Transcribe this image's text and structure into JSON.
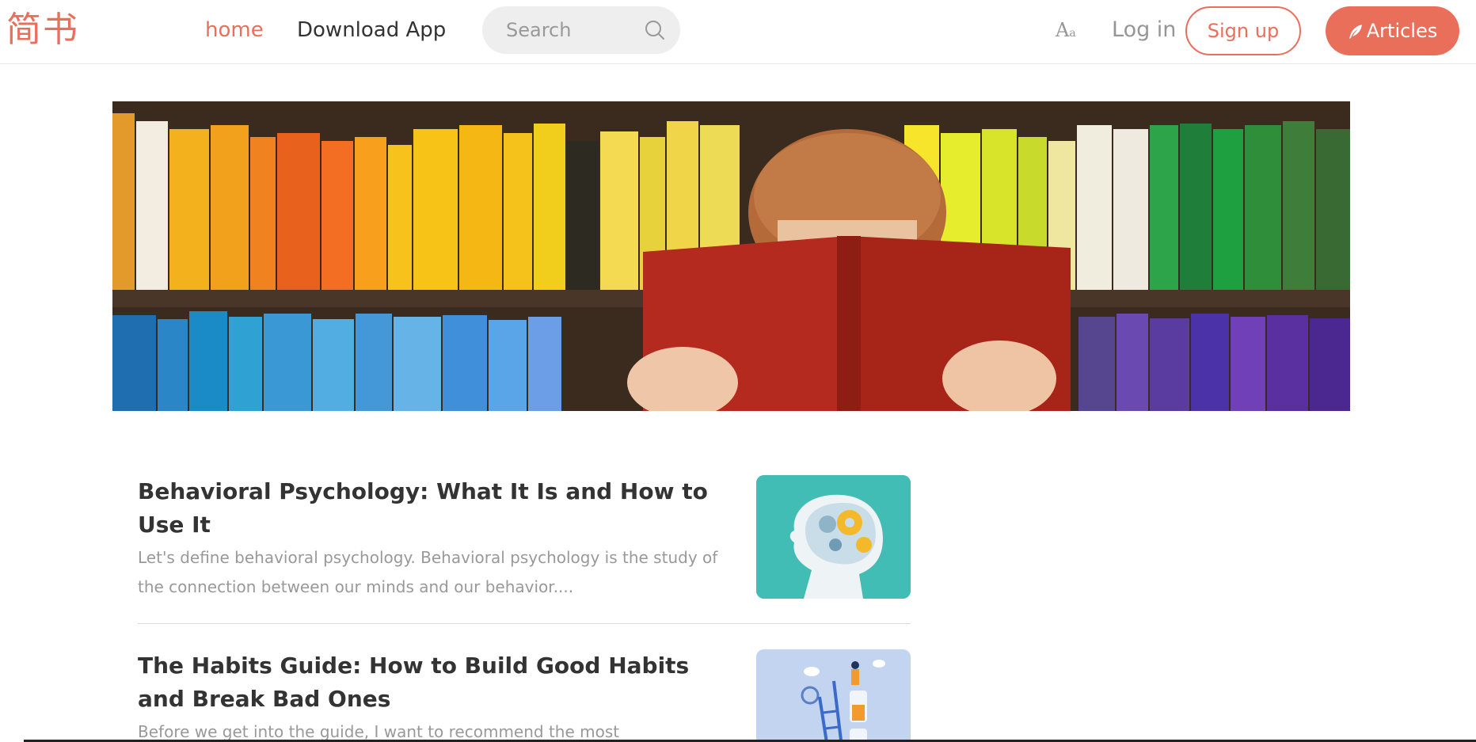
{
  "header": {
    "logo": "简书",
    "nav": {
      "home": "home",
      "download": "Download App"
    },
    "search": {
      "placeholder": "Search",
      "icon": "search-icon"
    },
    "font_toggle": {
      "big": "A",
      "small": "a"
    },
    "login": "Log in",
    "signup": "Sign up",
    "write": "Articles"
  },
  "colors": {
    "accent": "#ea6f5a",
    "text": "#333333",
    "muted": "#969696",
    "abstract": "#999999"
  },
  "banner": {
    "description_icon": "banner-image"
  },
  "articles": [
    {
      "title": "Behavioral Psychology: What It Is and How to Use It",
      "abstract": "Let's define behavioral psychology. Behavioral psychology is the study of the connection between our minds and our behavior....",
      "thumbnail_icon": "brain-gears-thumbnail"
    },
    {
      "title": "The Habits Guide: How to Build Good Habits and Break Bad Ones",
      "abstract": "Before we get into the guide, I want to recommend the most comprehensive",
      "thumbnail_icon": "habits-ladder-thumbnail"
    }
  ]
}
